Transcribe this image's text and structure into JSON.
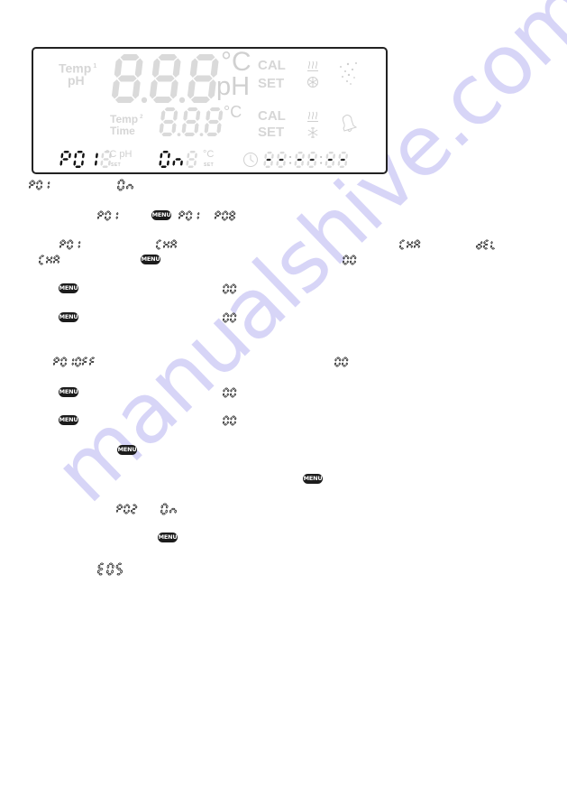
{
  "lcd": {
    "row1": {
      "label_line1": "Temp",
      "label_index": "1",
      "label_line2": "pH",
      "digits": "8.8.8",
      "unit_top": "°C",
      "unit_bottom": "pH",
      "cal": "CAL",
      "set": "SET"
    },
    "row2": {
      "label_line1": "Temp",
      "label_index": "2",
      "label_line2": "Time",
      "digits": "8.8.8",
      "unit_top": "°C",
      "cal": "CAL",
      "set": "SET"
    },
    "status": {
      "left_digits_active": "P01",
      "left_digits_ghost": "88.8",
      "left_unit": "°C pH",
      "left_set": "SET",
      "mid_digits_active": "On",
      "mid_digits_ghost": "88.8",
      "mid_unit": "°C",
      "mid_set": "SET",
      "clock": "--:--:--"
    },
    "icons": [
      "heat-icon",
      "cool-icon",
      "bubbles-icon",
      "heat-icon",
      "cool-icon",
      "bell-icon"
    ]
  },
  "body": {
    "line1": {
      "code_a": "P01",
      "code_b": "On"
    },
    "line2": {
      "code_a": "P01",
      "button": "MENU",
      "code_b": "P01",
      "code_c": "P08"
    },
    "line3": {
      "code_a": "P01",
      "code_b": "CHA",
      "code_c": "CHA",
      "code_d": "dEL"
    },
    "line4": {
      "code_a": "CHA",
      "button": "MENU",
      "code_b": "00"
    },
    "line5": {
      "button": "MENU",
      "code": "00"
    },
    "line6": {
      "button": "MENU",
      "code": "00"
    },
    "line7": {
      "code_a": "P01OFF",
      "code_b": "00"
    },
    "line8": {
      "button": "MENU",
      "code": "00"
    },
    "line9": {
      "button": "MENU",
      "code": "00"
    },
    "line10": {
      "button": "MENU"
    },
    "line11": {
      "button": "MENU"
    },
    "line12": {
      "code_a": "P02",
      "code_b": "On"
    },
    "line13": {
      "button": "MENU"
    },
    "line14": {
      "code": "E0S"
    }
  },
  "watermark": "manualshive.com",
  "colors": {
    "lcd_on": "#111111",
    "lcd_off": "#dadada",
    "button_bg": "#1c1c1c",
    "watermark": "#c9c6f4"
  }
}
